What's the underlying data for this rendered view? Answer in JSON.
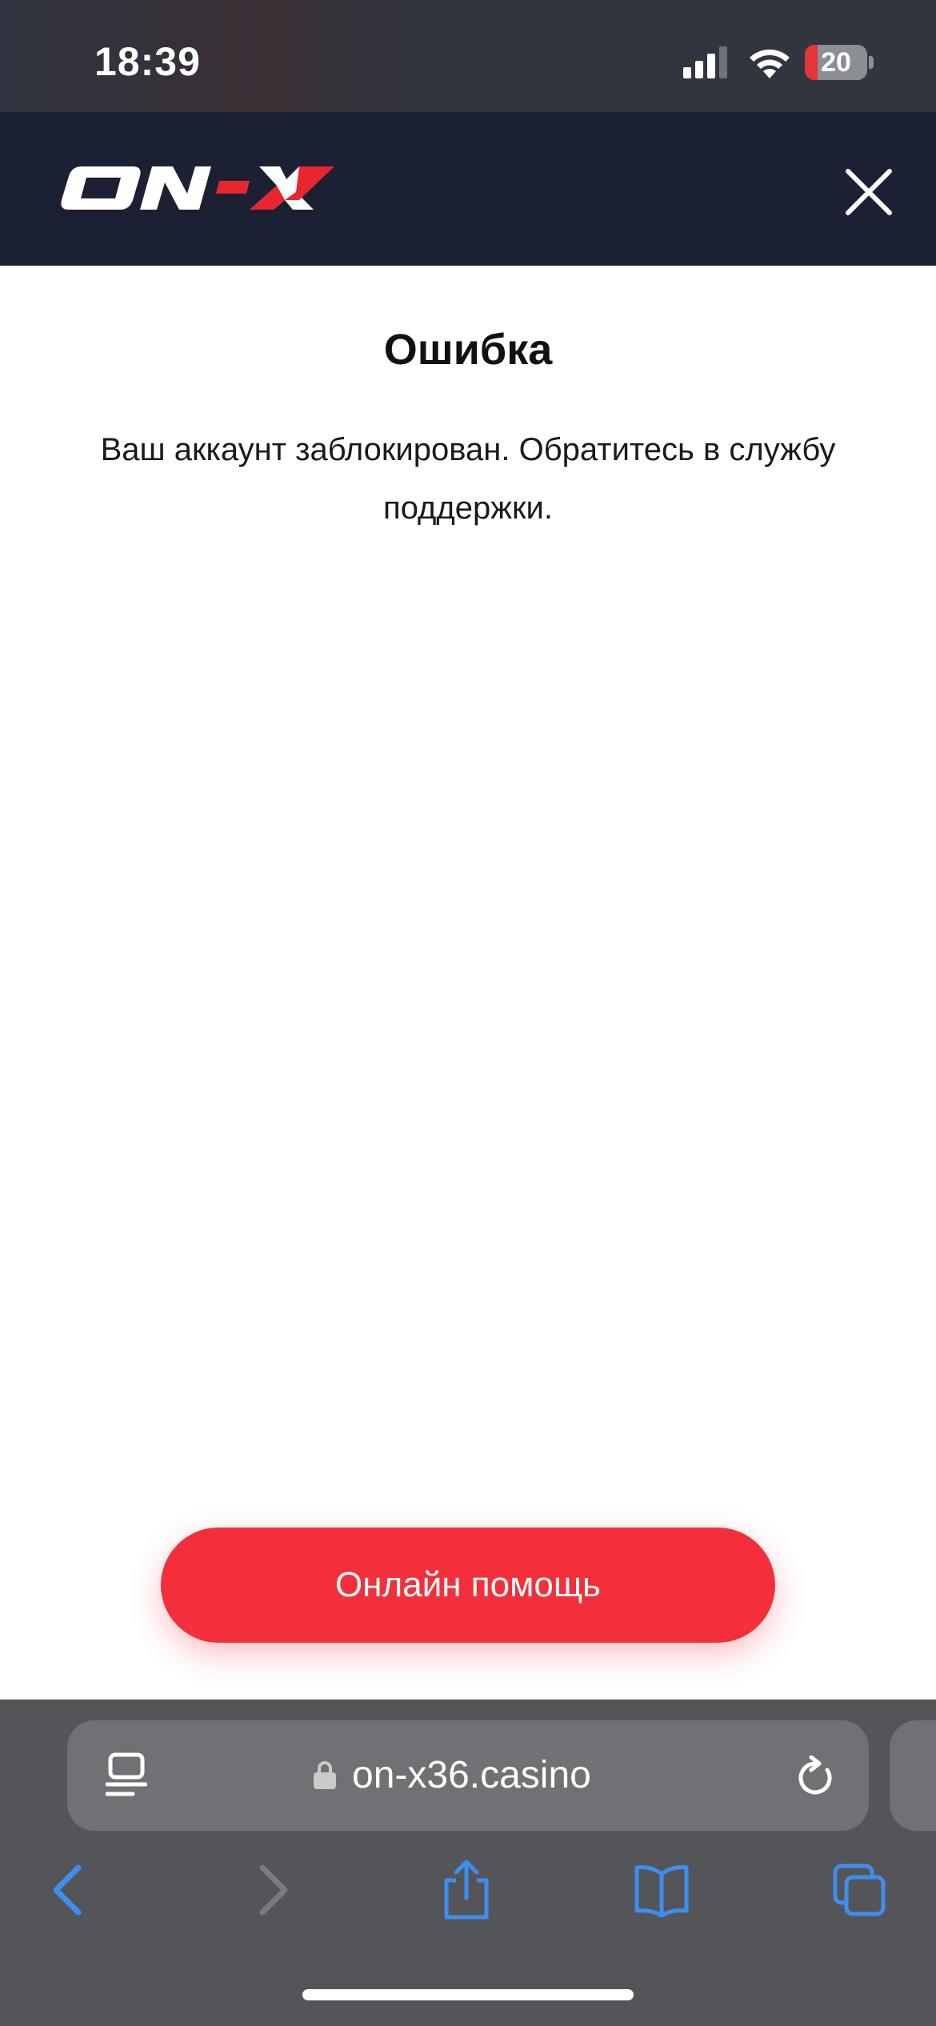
{
  "status_bar": {
    "time": "18:39",
    "battery_level": "20",
    "battery_fraction": 0.2,
    "icons": [
      "signal-icon",
      "wifi-icon",
      "battery-icon"
    ]
  },
  "header": {
    "logo_alt": "ON-X",
    "colors": {
      "background": "#1b2033",
      "accent": "#e8262f"
    }
  },
  "error": {
    "title": "Ошибка",
    "message": "Ваш аккаунт заблокирован. Обратитесь в службу поддержки."
  },
  "help_button": {
    "label": "Онлайн помощь",
    "color": "#f22f3b"
  },
  "browser": {
    "url": "on-x36.casino",
    "toolbar": [
      "back-icon",
      "forward-icon",
      "share-icon",
      "bookmarks-icon",
      "tabs-icon"
    ],
    "accent": "#3e8ef0"
  }
}
